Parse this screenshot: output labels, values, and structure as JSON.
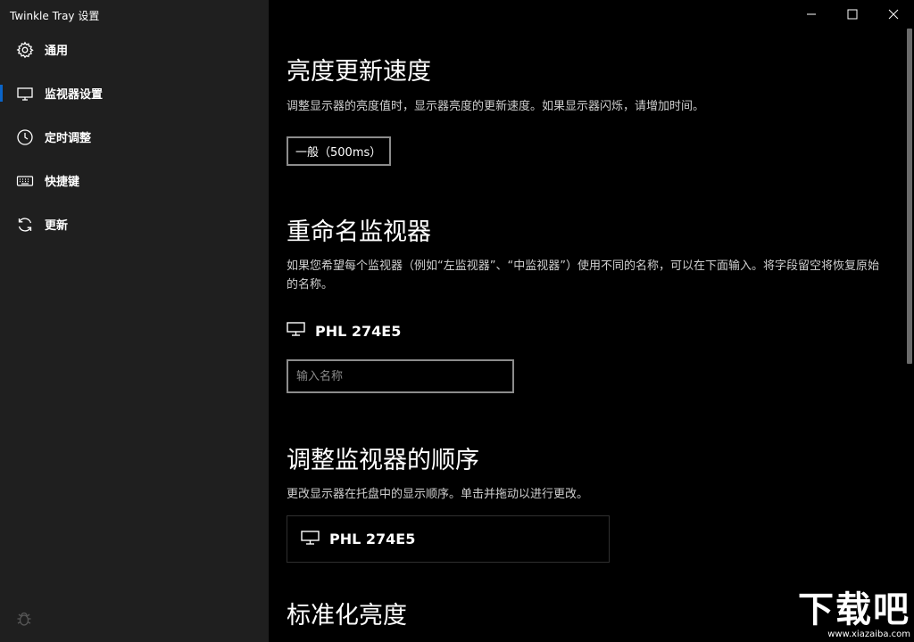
{
  "window": {
    "title": "Twinkle Tray 设置",
    "controls": [
      "minimize",
      "maximize",
      "close"
    ]
  },
  "sidebar": {
    "items": [
      {
        "label": "通用",
        "icon": "gear-icon",
        "active": false
      },
      {
        "label": "监视器设置",
        "icon": "monitor-icon",
        "active": true
      },
      {
        "label": "定时调整",
        "icon": "clock-icon",
        "active": false
      },
      {
        "label": "快捷键",
        "icon": "keyboard-icon",
        "active": false
      },
      {
        "label": "更新",
        "icon": "refresh-icon",
        "active": false
      }
    ],
    "footer_icon": "bug-icon"
  },
  "sections": {
    "speed": {
      "title": "亮度更新速度",
      "desc": "调整显示器的亮度值时，显示器亮度的更新速度。如果显示器闪烁，请增加时间。",
      "selected": "一般（500ms）"
    },
    "rename": {
      "title": "重命名监视器",
      "desc": "如果您希望每个监视器（例如“左监视器”、“中监视器”）使用不同的名称，可以在下面输入。将字段留空将恢复原始的名称。",
      "monitor_name": "PHL 274E5",
      "input_placeholder": "输入名称",
      "input_value": ""
    },
    "order": {
      "title": "调整监视器的顺序",
      "desc": "更改显示器在托盘中的显示顺序。单击并拖动以进行更改。",
      "monitors": [
        "PHL 274E5"
      ]
    },
    "normalize": {
      "title": "标准化亮度"
    }
  },
  "watermark": {
    "main": "下载吧",
    "sub": "www.xiazaiba.com"
  },
  "colors": {
    "sidebar_bg": "#1f1f1f",
    "main_bg": "#000000",
    "accent": "#0a64c8"
  }
}
